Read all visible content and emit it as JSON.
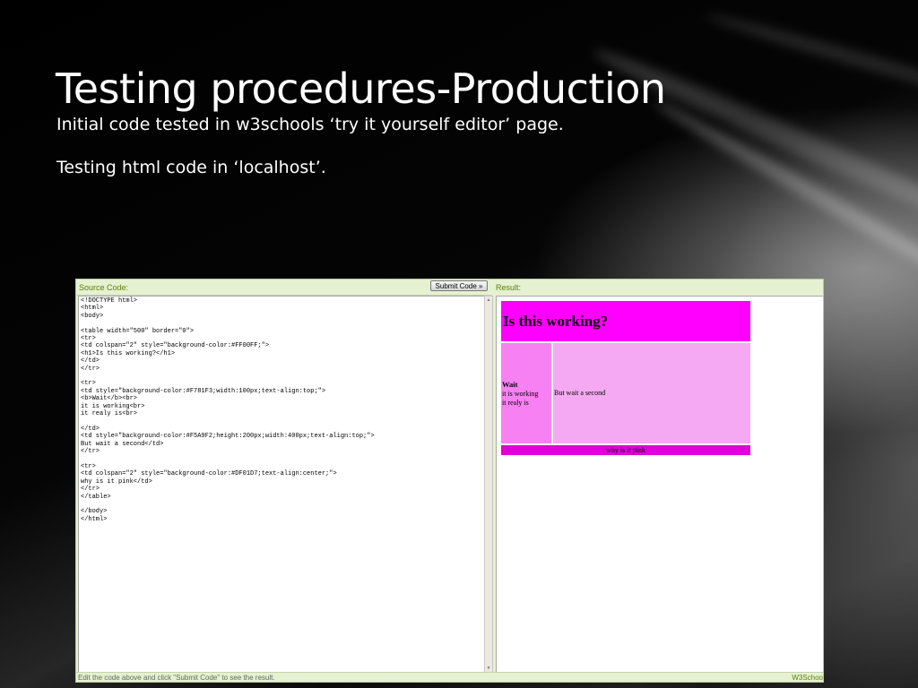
{
  "slide": {
    "title": "Testing procedures-Production",
    "bullet1": "Initial code tested in w3schools ‘try it yourself editor’ page.",
    "bullet2": "Testing html code in ‘localhost’."
  },
  "editor": {
    "source_label": "Source Code:",
    "submit_label": "Submit Code »",
    "result_label": "Result:",
    "code": "<!DOCTYPE html>\n<html>\n<body>\n\n<table width=\"500\" border=\"0\">\n<tr>\n<td colspan=\"2\" style=\"background-color:#FF00FF;\">\n<h1>Is this working?</h1>\n</td>\n</tr>\n\n<tr>\n<td style=\"background-color:#F781F3;width:100px;text-align:top;\">\n<b>Wait</b><br>\nit is working<br>\nit realy is<br>\n\n</td>\n<td style=\"background-color:#F5A9F2;height:200px;width:400px;text-align:top;\">\nBut wait a second</td>\n</tr>\n\n<tr>\n<td colspan=\"2\" style=\"background-color:#DF01D7;text-align:center;\">\nwhy is it pink</td>\n</tr>\n</table>\n\n</body>\n</html>",
    "footer_hint": "Edit the code above and click \"Submit Code\" to see the result.",
    "footer_brand": "W3Schoo"
  },
  "result": {
    "heading": "Is this working?",
    "left_bold": "Wait",
    "left_line1": "it is working",
    "left_line2": "it realy is",
    "right_text": "But wait a second",
    "bottom_text": "why is it pink"
  },
  "colors": {
    "top_cell": "#FF00FF",
    "left_cell": "#F781F3",
    "right_cell": "#F5A9F2",
    "bottom_cell": "#DF01D7",
    "label_green": "#617F10"
  }
}
